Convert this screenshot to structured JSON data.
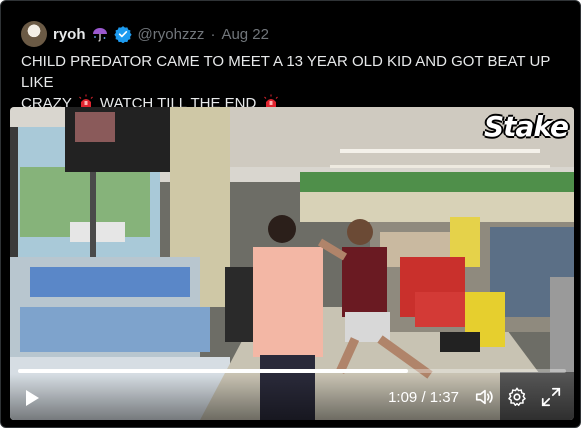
{
  "tweet": {
    "display_name": "ryoh",
    "handle": "@ryohzzz",
    "separator": "·",
    "date": "Aug 22",
    "text_line1": "CHILD PREDATOR CAME TO MEET A 13 YEAR OLD KID AND GOT BEAT UP LIKE",
    "text_line2_a": "CRAZY",
    "text_line2_b": "WATCH TILL THE END"
  },
  "icons": {
    "umbrella": "umbrella-rain-emoji-icon",
    "verified": "verified-badge-icon",
    "siren": "police-siren-emoji-icon",
    "play": "play-icon",
    "volume": "volume-icon",
    "settings": "gear-icon",
    "fullscreen": "fullscreen-icon"
  },
  "video": {
    "watermark": "Stake",
    "current_time": "1:09",
    "time_separator": " / ",
    "duration": "1:37",
    "progress_fraction": 0.711
  },
  "colors": {
    "background": "#000000",
    "text": "#e7e9ea",
    "muted": "#71767b",
    "verified": "#1d9bf0",
    "siren_red": "#e0242f"
  }
}
